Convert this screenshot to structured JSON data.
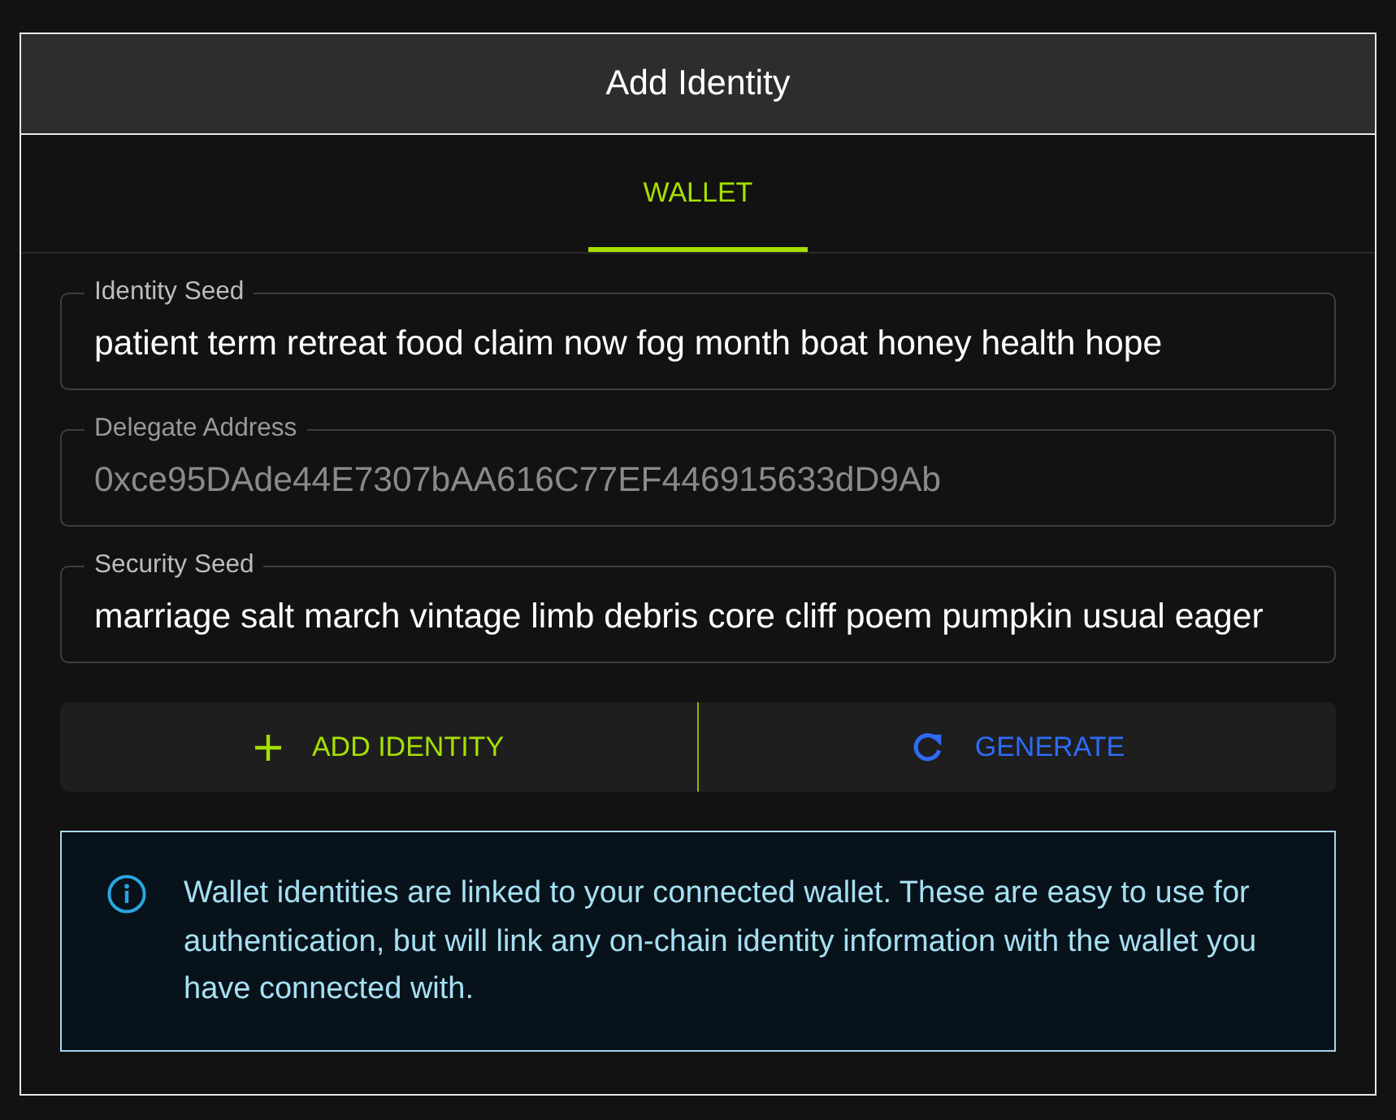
{
  "dialog": {
    "title": "Add Identity"
  },
  "tabs": [
    {
      "label": "WALLET",
      "selected": true
    }
  ],
  "fields": [
    {
      "label": "Identity Seed",
      "value": "patient term retreat food claim now fog month boat honey health hope",
      "disabled": false
    },
    {
      "label": "Delegate Address",
      "value": "0xce95DAde44E7307bAA616C77EF446915633dD9Ab",
      "disabled": true
    },
    {
      "label": "Security Seed",
      "value": "marriage salt march vintage limb debris core cliff poem pumpkin usual eager",
      "disabled": false
    }
  ],
  "actions": [
    {
      "kind": "add",
      "label": "ADD IDENTITY"
    },
    {
      "kind": "generate",
      "label": "GENERATE"
    }
  ],
  "notice": {
    "text": "Wallet identities are linked to your connected wallet. These are easy to use for authentication, but will link any on-chain identity information with the wallet you have connected with."
  }
}
